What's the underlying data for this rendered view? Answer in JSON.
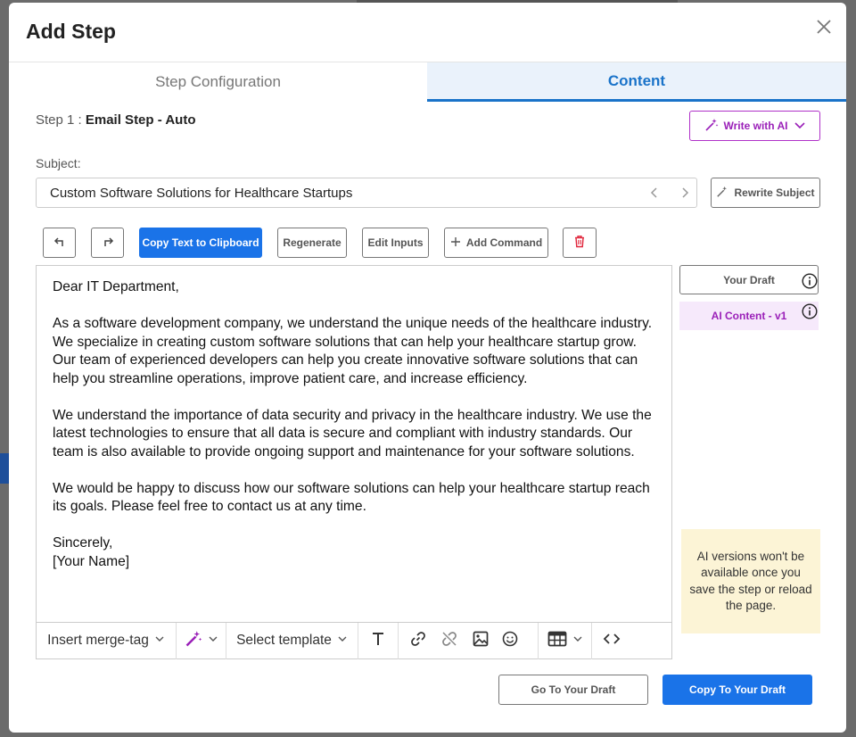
{
  "modal": {
    "title": "Add Step"
  },
  "tabs": [
    {
      "label": "Step Configuration",
      "active": false
    },
    {
      "label": "Content",
      "active": true
    }
  ],
  "step": {
    "prefix": "Step 1 : ",
    "name": "Email Step - Auto"
  },
  "write_ai": {
    "label": "Write with AI",
    "icon": "magic-wand-icon"
  },
  "subject": {
    "label": "Subject:",
    "value": "Custom Software Solutions for Healthcare Startups"
  },
  "rewrite_subject": {
    "label": "Rewrite Subject"
  },
  "toolbar": {
    "copy_label": "Copy Text to Clipboard",
    "regenerate_label": "Regenerate",
    "edit_inputs_label": "Edit Inputs",
    "add_command_label": "Add Command"
  },
  "email": {
    "greeting": "Dear IT Department,",
    "paragraph_1": "As a software development company, we understand the unique needs of the healthcare industry. We specialize in creating custom software solutions that can help your healthcare startup grow. Our team of experienced developers can help you create innovative software solutions that can help you streamline operations, improve patient care, and increase efficiency.",
    "paragraph_2": "We understand the importance of data security and privacy in the healthcare industry. We use the latest technologies to ensure that all data is secure and compliant with industry standards. Our team is also available to provide ongoing support and maintenance for your software solutions.",
    "paragraph_3": "We would be happy to discuss how our software solutions can help your healthcare startup reach its goals. Please feel free to contact us at any time.",
    "closing": "Sincerely,",
    "signature": "[Your Name]"
  },
  "editor_toolbar": {
    "merge_tag_label": "Insert merge-tag",
    "template_label": "Select template"
  },
  "versions": {
    "draft_label": "Your Draft",
    "ai_label": "AI Content - v1"
  },
  "warning": {
    "text": "AI versions won't be available once you save the step or reload the page."
  },
  "footer": {
    "goto_label": "Go To Your Draft",
    "copy_label": "Copy To Your Draft"
  },
  "colors": {
    "primary": "#1a73e8",
    "ai_purple": "#9a1fb8",
    "active_tab": "#1a73c9",
    "warning_bg": "#fcf4d6"
  }
}
